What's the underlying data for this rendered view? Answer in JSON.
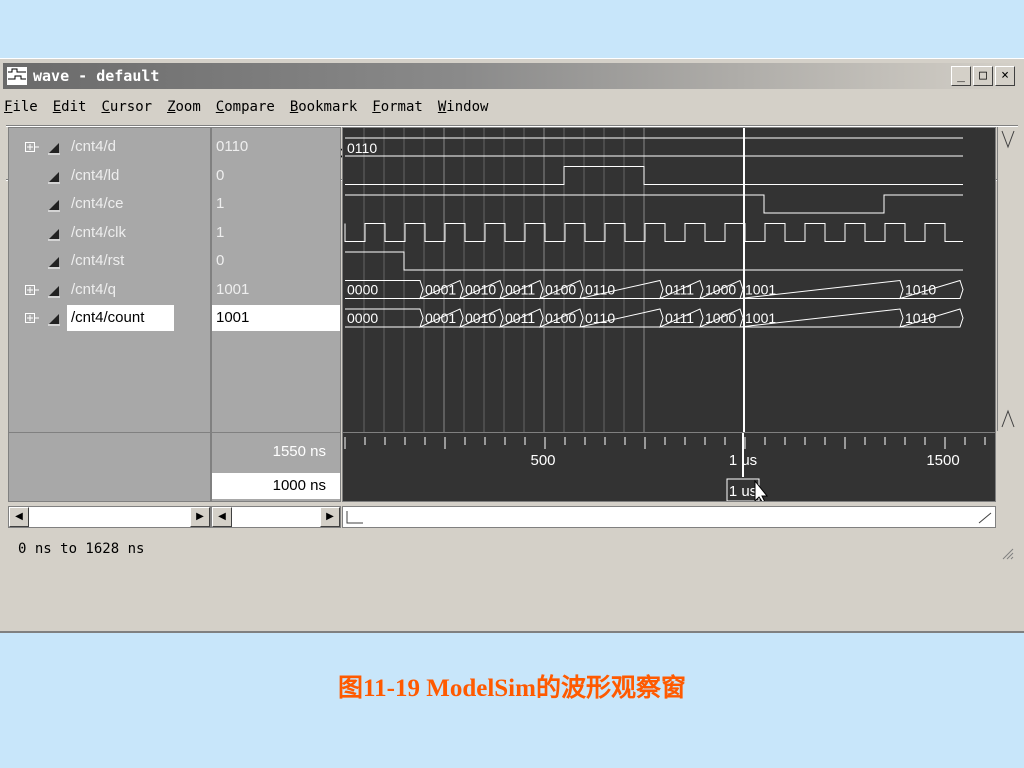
{
  "window": {
    "title": "wave - default",
    "controls": {
      "minimize": "_",
      "maximize": "□",
      "close": "×"
    }
  },
  "menu": [
    "File",
    "Edit",
    "Cursor",
    "Zoom",
    "Compare",
    "Bookmark",
    "Format",
    "Window"
  ],
  "toolbar_icons": [
    [
      "open-icon",
      "save-icon",
      "print-icon"
    ],
    [
      "cut-icon",
      "copy-icon",
      "paste-icon"
    ],
    [
      "select-pointer-icon",
      "delete-icon",
      "left-right-icon"
    ],
    [
      "zoom-in-icon",
      "zoom-out-icon",
      "zoom-full-icon",
      "zoom-search-icon",
      "zoom-range-icon"
    ],
    [
      "insert-cursor-icon"
    ],
    [
      "edge-prev-icon",
      "edge-next-icon",
      "edge-fall-icon",
      "delete-cursor-icon"
    ],
    [
      "find-first-icon",
      "find-prev-icon",
      "find-next-icon",
      "find-last-icon",
      "find-end-icon"
    ]
  ],
  "signals": [
    {
      "name": "/cnt4/d",
      "value": "0110",
      "expandable": true
    },
    {
      "name": "/cnt4/ld",
      "value": "0",
      "expandable": false
    },
    {
      "name": "/cnt4/ce",
      "value": "1",
      "expandable": false
    },
    {
      "name": "/cnt4/clk",
      "value": "1",
      "expandable": false
    },
    {
      "name": "/cnt4/rst",
      "value": "0",
      "expandable": false
    },
    {
      "name": "/cnt4/q",
      "value": "1001",
      "expandable": true
    },
    {
      "name": "/cnt4/count",
      "value": "1001",
      "expandable": true,
      "selected": true
    }
  ],
  "waves": {
    "d_label": "0110",
    "bus_labels": [
      "0000",
      "0001",
      "0010",
      "0011",
      "0100",
      "0110",
      "0111",
      "1000",
      "1001",
      "1010"
    ]
  },
  "cursors": {
    "now": "1550 ns",
    "cursor1": "1000 ns",
    "cursor_marker": "1 us"
  },
  "timeline": {
    "labels": [
      "500",
      "1 us",
      "1500"
    ]
  },
  "status": {
    "range": "0 ns to 1628 ns"
  },
  "caption": "图11-19  ModelSim的波形观察窗",
  "colors": {
    "background": "#c8e6fa",
    "wave_bg": "#333333",
    "name_pane_bg": "#a8a8a8",
    "caption": "#ff5a00"
  }
}
